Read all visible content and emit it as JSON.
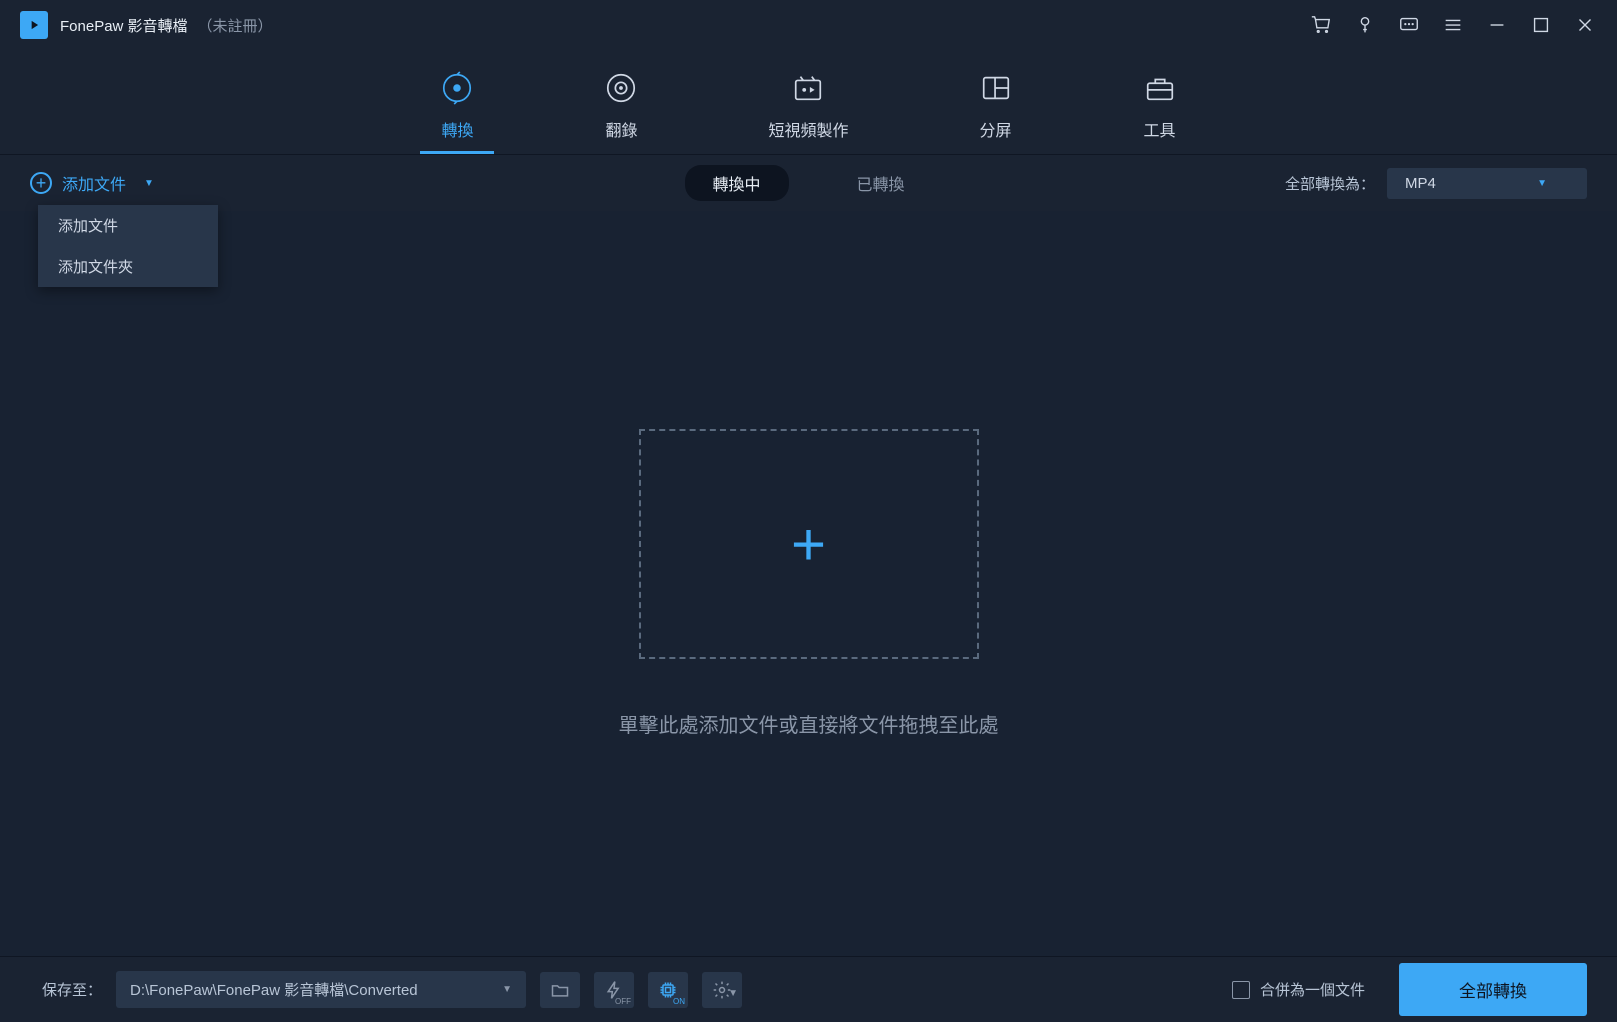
{
  "titlebar": {
    "app_name": "FonePaw 影音轉檔",
    "reg_status": "（未註冊）"
  },
  "main_tabs": [
    {
      "label": "轉換",
      "icon": "convert",
      "active": true
    },
    {
      "label": "翻錄",
      "icon": "rip",
      "active": false
    },
    {
      "label": "短視頻製作",
      "icon": "video-maker",
      "active": false
    },
    {
      "label": "分屏",
      "icon": "split-screen",
      "active": false
    },
    {
      "label": "工具",
      "icon": "toolbox",
      "active": false
    }
  ],
  "subbar": {
    "add_file": "添加文件",
    "dropdown": [
      "添加文件",
      "添加文件夾"
    ],
    "sub_tabs": [
      {
        "label": "轉換中",
        "active": true
      },
      {
        "label": "已轉換",
        "active": false
      }
    ],
    "convert_all_label": "全部轉換為：",
    "format_selected": "MP4"
  },
  "dropzone": {
    "hint": "單擊此處添加文件或直接將文件拖拽至此處"
  },
  "bottombar": {
    "save_label": "保存至：",
    "save_path": "D:\\FonePaw\\FonePaw 影音轉檔\\Converted",
    "hw_off": "OFF",
    "hw_on": "ON",
    "merge_label": "合併為一個文件",
    "convert_btn": "全部轉換"
  }
}
